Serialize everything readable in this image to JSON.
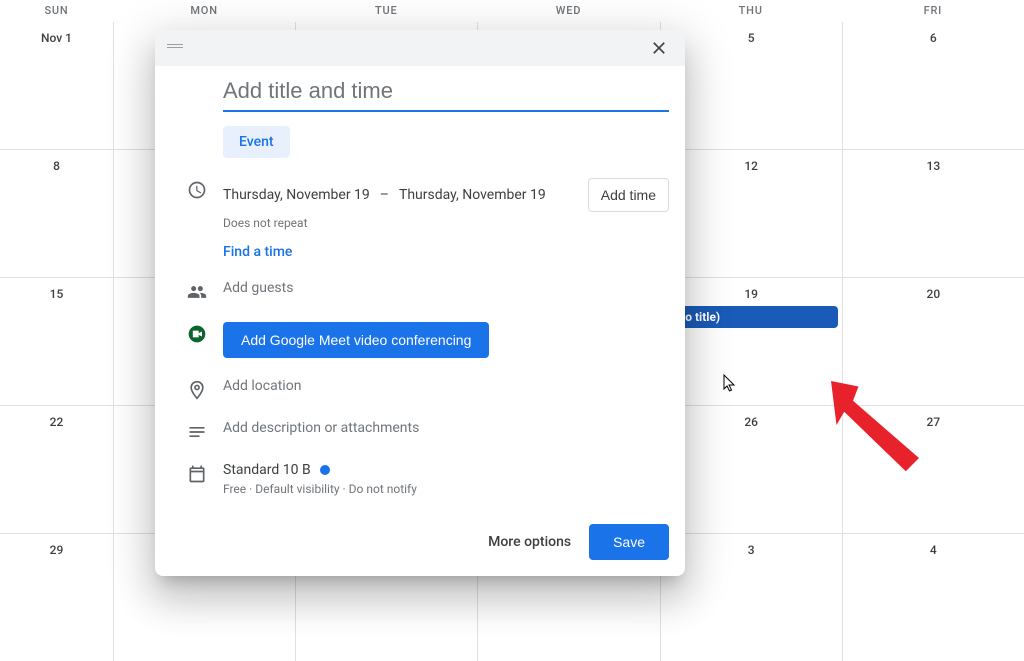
{
  "dayHeaders": [
    "SUN",
    "MON",
    "TUE",
    "WED",
    "THU",
    "FRI"
  ],
  "weeks": [
    [
      "Nov 1",
      "",
      "",
      "",
      "5",
      "6"
    ],
    [
      "8",
      "",
      "",
      "",
      "12",
      "13"
    ],
    [
      "15",
      "",
      "",
      "",
      "19",
      "20"
    ],
    [
      "22",
      "",
      "",
      "",
      "26",
      "27"
    ],
    [
      "29",
      "",
      "",
      "",
      "3",
      "4"
    ]
  ],
  "event": {
    "title": "(No title)",
    "weekIndex": 2,
    "dayIndex": 4
  },
  "modal": {
    "title_placeholder": "Add title and time",
    "tab_event": "Event",
    "date_start": "Thursday, November 19",
    "date_sep": "–",
    "date_end": "Thursday, November 19",
    "repeat": "Does not repeat",
    "add_time": "Add time",
    "find_time": "Find a time",
    "add_guests": "Add guests",
    "meet_button": "Add Google Meet video conferencing",
    "add_location": "Add location",
    "add_description": "Add description or attachments",
    "calendar_name": "Standard 10 B",
    "visibility_line": "Free · Default visibility · Do not notify",
    "more_options": "More options",
    "save": "Save"
  }
}
